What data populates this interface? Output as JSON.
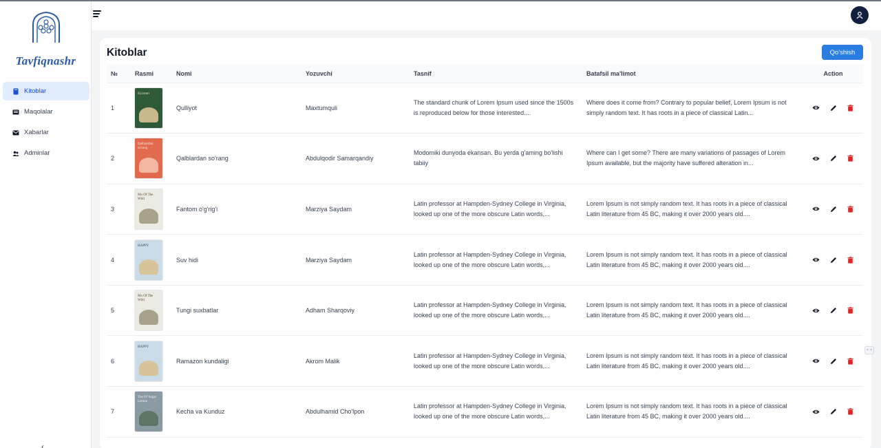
{
  "brand": {
    "name": "Tavfiqnashr"
  },
  "sidebar": {
    "items": [
      {
        "label": "Kitoblar",
        "icon": "book-icon",
        "active": true
      },
      {
        "label": "Maqolalar",
        "icon": "newspaper-icon",
        "active": false
      },
      {
        "label": "Xabarlar",
        "icon": "envelope-icon",
        "active": false
      },
      {
        "label": "Adminlar",
        "icon": "users-icon",
        "active": false
      }
    ],
    "collapse_label": "‹"
  },
  "header": {
    "menu_icon": "hamburger-icon",
    "avatar_icon": "user-icon"
  },
  "page": {
    "title": "Kitoblar",
    "add_button": "Qo'shish",
    "columns": [
      "№",
      "Rasmi",
      "Nomi",
      "Yozuvchi",
      "Tasnif",
      "Batafsil ma'limot",
      "Action"
    ],
    "rows": [
      {
        "num": "1",
        "name": "Qulliyot",
        "author": "Maxtumquli",
        "summary": "The standard chunk of Lorem Ipsum used since the 1500s is reproduced below for those interested....",
        "details": "Where does it come from? Contrary to popular belief, Lorem Ipsum is not simply random text. It has roots in a piece of classical Latin...",
        "cover": {
          "bg": "#2f5a3a",
          "fg": "#e8dfb5",
          "art": "#c9b98a",
          "text": "Куллият"
        }
      },
      {
        "num": "2",
        "name": "Qalblardan so'rang",
        "author": "Abdulqodir Samarqandiy",
        "summary": "Modomiki dunyoda ekansan. Bu yerda g'aming bo'lishi tabiiy",
        "details": "Where can I get some? There are many variations of passages of Lorem Ipsum available, but the majority have suffered alteration in...",
        "cover": {
          "bg": "#e26a4f",
          "fg": "#fde8d8",
          "art": "#f4b7a4",
          "text": "Qalblardan so'rang"
        }
      },
      {
        "num": "3",
        "name": "Fantom o'g'rig'i",
        "author": "Marziya Saydam",
        "summary": "Latin professor at Hampden-Sydney College in Virginia, looked up one of the more obscure Latin words,...",
        "details": "Lorem Ipsum is not simply random text. It has roots in a piece of classical Latin literature from 45 BC, making it over 2000 years old....",
        "cover": {
          "bg": "#ecebe3",
          "fg": "#5b4a2e",
          "art": "#a7a48a",
          "text": "Mo Of The Wild"
        }
      },
      {
        "num": "4",
        "name": "Suv hidi",
        "author": "Marziya Saydam",
        "summary": "Latin professor at Hampden-Sydney College in Virginia, looked up one of the more obscure Latin words,...",
        "details": "Lorem Ipsum is not simply random text. It has roots in a piece of classical Latin literature from 45 BC, making it over 2000 years old....",
        "cover": {
          "bg": "#c9dbe6",
          "fg": "#3b4b5e",
          "art": "#d8c49a",
          "text": "HAPPY"
        }
      },
      {
        "num": "5",
        "name": "Tungi suxbatlar",
        "author": "Adham Sharqoviy",
        "summary": "Latin professor at Hampden-Sydney College in Virginia, looked up one of the more obscure Latin words,...",
        "details": "Lorem Ipsum is not simply random text. It has roots in a piece of classical Latin literature from 45 BC, making it over 2000 years old....",
        "cover": {
          "bg": "#ecebe3",
          "fg": "#5b4a2e",
          "art": "#a7a48a",
          "text": "Mo Of The Wild"
        }
      },
      {
        "num": "6",
        "name": "Ramazon kundaligi",
        "author": "Akrom Malik",
        "summary": "Latin professor at Hampden-Sydney College in Virginia, looked up one of the more obscure Latin words,...",
        "details": "Lorem Ipsum is not simply random text. It has roots in a piece of classical Latin literature from 45 BC, making it over 2000 years old....",
        "cover": {
          "bg": "#c9dbe6",
          "fg": "#3b4b5e",
          "art": "#d8c49a",
          "text": "HAPPY"
        }
      },
      {
        "num": "7",
        "name": "Kecha va Kunduz",
        "author": "Abdulhamid Cho'lpon",
        "summary": "Latin professor at Hampden-Sydney College in Virginia, looked up one of the more obscure Latin words,...",
        "details": "Lorem Ipsum is not simply random text. It has roots in a piece of classical Latin literature from 45 BC, making it over 2000 years old....",
        "cover": {
          "bg": "#8a9aa3",
          "fg": "#f1f5f9",
          "art": "#5d7466",
          "text": "The Of Sugar Lemon"
        }
      }
    ],
    "action_icons": [
      "eye-icon",
      "pencil-icon",
      "trash-icon"
    ]
  },
  "colors": {
    "accent": "#2a7de1",
    "brand_text": "#2b5aa8",
    "active_bg": "#e0ecfb",
    "delete": "#dc2626",
    "avatar_bg": "#0f1f3d"
  }
}
